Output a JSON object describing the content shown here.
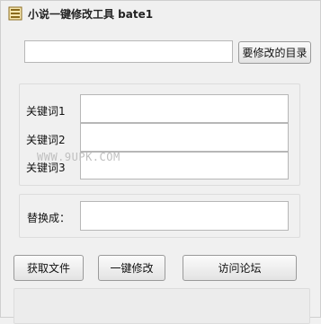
{
  "window": {
    "title": "小说一键修改工具 bate1"
  },
  "directory": {
    "value": "",
    "button_label": "要修改的目录"
  },
  "keywords": {
    "label_1": "关键词1",
    "label_2": "关键词2",
    "label_3": "关键词3",
    "value_1": "",
    "value_2": "",
    "value_3": ""
  },
  "replace": {
    "label": "替换成：",
    "value": ""
  },
  "actions": {
    "get_file_label": "获取文件",
    "one_click_label": "一键修改",
    "forum_label": "访问论坛"
  },
  "watermark": "WWW.9UPK.COM"
}
